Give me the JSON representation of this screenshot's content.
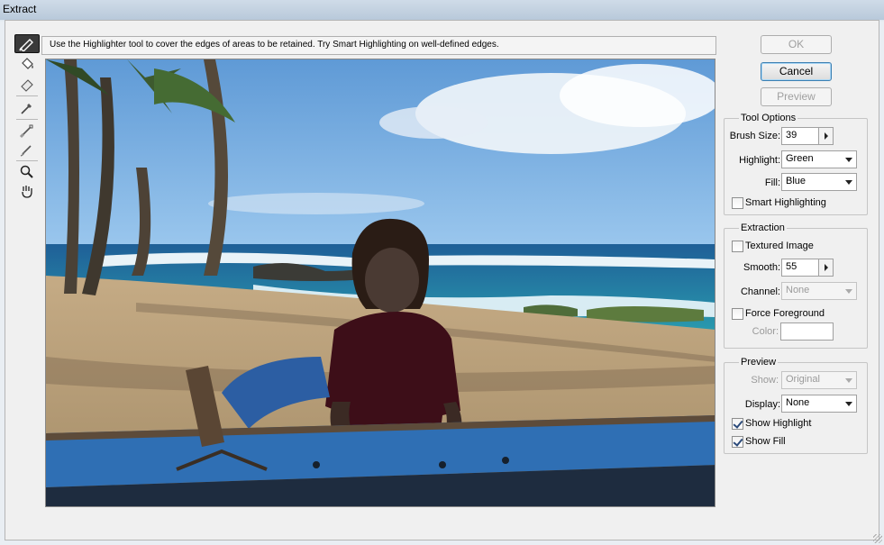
{
  "window": {
    "title": "Extract"
  },
  "hint": "Use the Highlighter tool to cover the edges of areas to be retained. Try Smart Highlighting on well-defined edges.",
  "tools": [
    {
      "name": "edge-highlighter-tool",
      "icon": "highlighter-icon",
      "active": true
    },
    {
      "name": "fill-tool",
      "icon": "paint-bucket-icon"
    },
    {
      "name": "eraser-tool",
      "icon": "eraser-icon"
    },
    {
      "name": "eyedropper-tool",
      "icon": "eyedropper-icon"
    },
    {
      "name": "cleanup-tool",
      "icon": "cleanup-brush-icon"
    },
    {
      "name": "edge-touchup-tool",
      "icon": "edge-touchup-icon"
    },
    {
      "name": "zoom-tool",
      "icon": "magnifier-icon"
    },
    {
      "name": "hand-tool",
      "icon": "hand-icon"
    }
  ],
  "buttons": {
    "ok": "OK",
    "cancel": "Cancel",
    "preview": "Preview"
  },
  "tool_options": {
    "legend": "Tool Options",
    "brush_size_label": "Brush Size:",
    "brush_size_value": "39",
    "highlight_label": "Highlight:",
    "highlight_value": "Green",
    "fill_label": "Fill:",
    "fill_value": "Blue",
    "smart_highlighting_label": "Smart Highlighting",
    "smart_highlighting_checked": false
  },
  "extraction": {
    "legend": "Extraction",
    "textured_image_label": "Textured Image",
    "textured_image_checked": false,
    "smooth_label": "Smooth:",
    "smooth_value": "55",
    "channel_label": "Channel:",
    "channel_value": "None",
    "force_foreground_label": "Force Foreground",
    "force_foreground_checked": false,
    "color_label": "Color:"
  },
  "preview": {
    "legend": "Preview",
    "show_label": "Show:",
    "show_value": "Original",
    "display_label": "Display:",
    "display_value": "None",
    "show_highlight_label": "Show Highlight",
    "show_highlight_checked": true,
    "show_fill_label": "Show Fill",
    "show_fill_checked": true
  },
  "colors": {
    "accent": "#3c7fb1",
    "canvas_sky": "#7fb6e6",
    "canvas_sand": "#b9a07a",
    "boat_blue": "#2d6fb0"
  }
}
